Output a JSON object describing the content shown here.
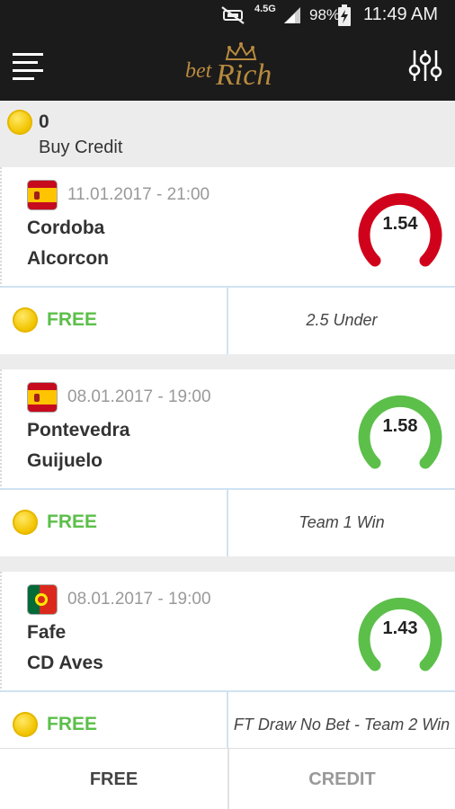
{
  "status_bar": {
    "network": "4.5G",
    "battery_percent": "98%",
    "time": "11:49 AM",
    "icons": [
      "mute-icon",
      "signal-icon",
      "battery-charging-icon"
    ]
  },
  "app_bar": {
    "logo_text": "betRich",
    "icons": [
      "menu-icon",
      "crown-icon",
      "filter-sliders-icon"
    ]
  },
  "credit": {
    "count": "0",
    "buy_label": "Buy Credit"
  },
  "matches": [
    {
      "flag": "spain-flag",
      "date": "11.01.2017 - 21:00",
      "home": "Cordoba",
      "away": "Alcorcon",
      "odds": "1.54",
      "status_color": "#d0021b",
      "access": "FREE",
      "tip": "2.5 Under"
    },
    {
      "flag": "spain-flag",
      "date": "08.01.2017 - 19:00",
      "home": "Pontevedra",
      "away": "Guijuelo",
      "odds": "1.58",
      "status_color": "#5cbf4a",
      "access": "FREE",
      "tip": "Team 1 Win"
    },
    {
      "flag": "portugal-flag",
      "date": "08.01.2017 - 19:00",
      "home": "Fafe",
      "away": "CD Aves",
      "odds": "1.43",
      "status_color": "#5cbf4a",
      "access": "FREE",
      "tip": "FT Draw No Bet - Team 2 Win"
    }
  ],
  "bottom_nav": {
    "free_label": "FREE",
    "credit_label": "CREDIT"
  },
  "colors": {
    "bar_background": "#1b1b1b",
    "free_green": "#5cbf4a",
    "lost_red": "#d0021b",
    "logo_gold": "#b88a3e",
    "coin_yellow": "#f2c500"
  }
}
